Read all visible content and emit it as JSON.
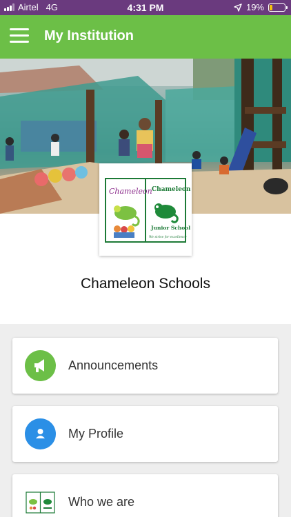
{
  "status_bar": {
    "carrier": "Airtel",
    "network": "4G",
    "time": "4:31 PM",
    "battery": "19%",
    "battery_level": 0.19
  },
  "app_bar": {
    "title": "My Institution",
    "menu_icon": "hamburger-icon"
  },
  "institution": {
    "name": "Chameleon Schools",
    "logo": {
      "left_text": "Chameleon",
      "right_text": "Chameleon",
      "right_subtext": "Junior School",
      "motto": "We strive for excellence"
    }
  },
  "menu": [
    {
      "label": "Announcements",
      "icon": "megaphone-icon",
      "color": "#6cbf47"
    },
    {
      "label": "My Profile",
      "icon": "person-icon",
      "color": "#2b8fe6"
    },
    {
      "label": "Who we are",
      "icon": "school-logo-icon"
    }
  ],
  "colors": {
    "status_bar": "#6a3a7e",
    "app_bar": "#6cbf47",
    "background": "#eeeeee"
  }
}
